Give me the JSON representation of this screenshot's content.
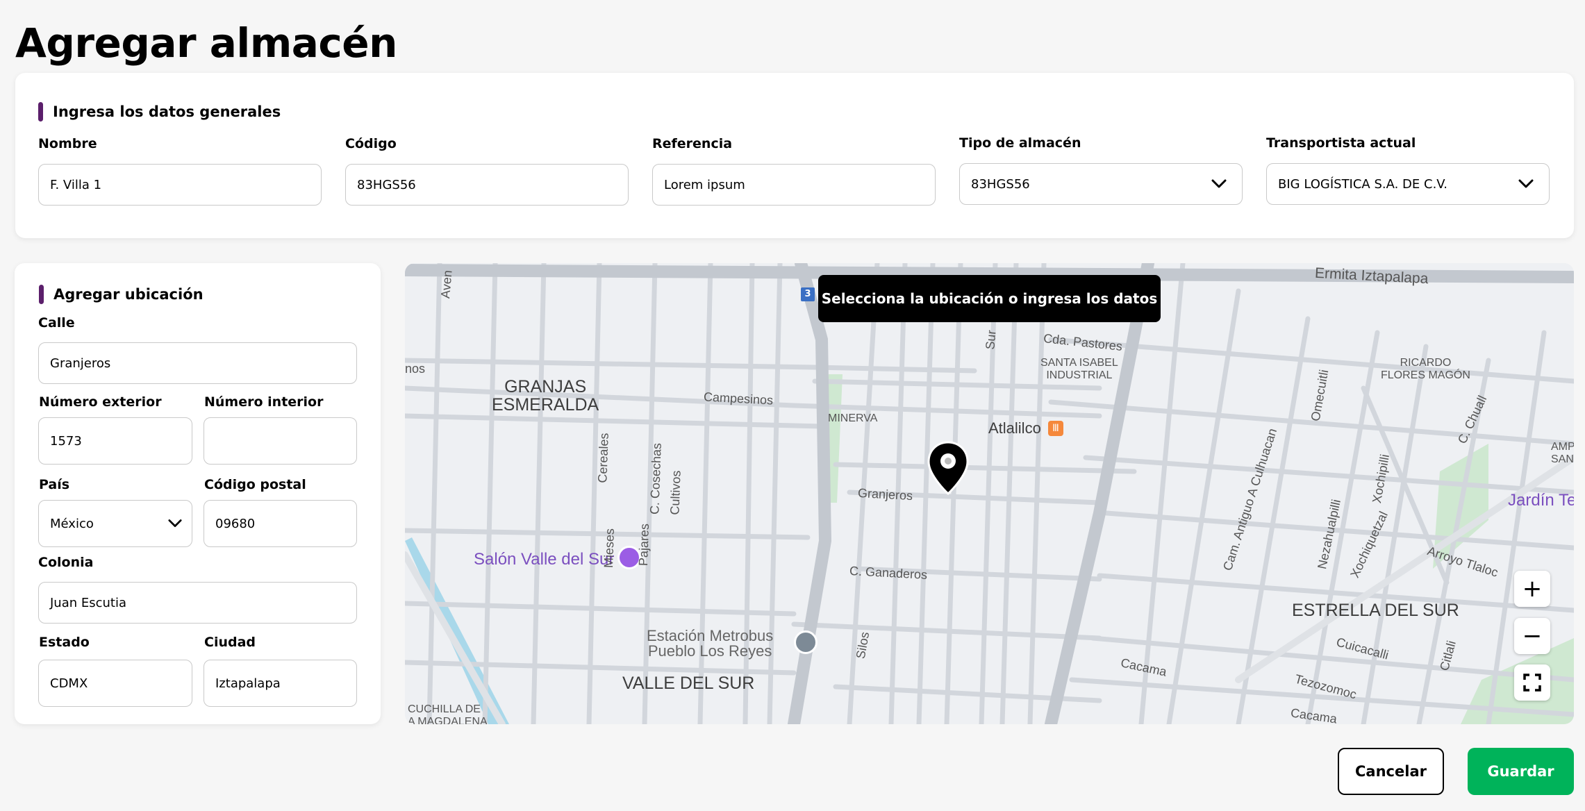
{
  "page": {
    "title": "Agregar almacén"
  },
  "general": {
    "section_title": "Ingresa los datos generales",
    "fields": {
      "nombre": {
        "label": "Nombre",
        "value": "F. Villa 1"
      },
      "codigo": {
        "label": "Código",
        "value": "83HGS56"
      },
      "referencia": {
        "label": "Referencia",
        "value": "Lorem ipsum"
      },
      "tipo": {
        "label": "Tipo de almacén",
        "value": "83HGS56"
      },
      "transportista": {
        "label": "Transportista actual",
        "value": "BIG LOGÍSTICA S.A. DE C.V."
      }
    }
  },
  "location": {
    "section_title": "Agregar ubicación",
    "fields": {
      "calle": {
        "label": "Calle",
        "value": "Granjeros"
      },
      "num_ext": {
        "label": "Número exterior",
        "value": "1573"
      },
      "num_int": {
        "label": "Número interior",
        "value": ""
      },
      "pais": {
        "label": "País",
        "value": "México"
      },
      "cp": {
        "label": "Código postal",
        "value": "09680"
      },
      "colonia": {
        "label": "Colonia",
        "value": "Juan Escutia"
      },
      "estado": {
        "label": "Estado",
        "value": "CDMX"
      },
      "ciudad": {
        "label": "Ciudad",
        "value": "Iztapalapa"
      }
    }
  },
  "map": {
    "tooltip": "Selecciona la ubicación o ingresa los datos",
    "zoom_in": "+",
    "zoom_out": "−",
    "fullscreen_icon": "fullscreen-icon",
    "marker_icon": "map-pin-icon",
    "labels": {
      "granjas": "GRANJAS\nESMERALDA",
      "valle": "VALLE DEL SUR",
      "estrella": "ESTRELLA DEL SUR",
      "santa_isabel": "SANTA ISABEL\nINDUSTRIAL",
      "ricardo": "RICARDO\nFLORES MAGÓN",
      "minerva": "MINERVA",
      "atlalilco": "Atlalilco",
      "salon": "Salón Valle del Sur",
      "estacion": "Estación Metrobus\nPueblo Los Reyes",
      "jardin": "Jardín Te",
      "ermita": "Ermita Iztapalapa",
      "pastores": "Cda. Pastores",
      "campesinos": "Campesinos",
      "granjeros": "Granjeros",
      "ganaderos": "C. Ganaderos",
      "cereales": "Cereales",
      "cosechas": "C. Cosechas",
      "cultivos": "Cultivos",
      "mieses": "Mieses",
      "pajares": "Pajares",
      "silos": "Silos",
      "cam_antiguo": "Cam. Antiguo A Culhuacan",
      "nezahualpilli": "Nezahualpilli",
      "xochiquetzal": "Xochiquetzal",
      "arroyo": "Arroyo Tlaloc",
      "cuicacalli": "Cuicacalli",
      "tezozomoc": "Tezozomoc",
      "cacama": "Cacama",
      "cacama2": "Cacama",
      "cuchilla": "CUCHILLA DE\nA MAGDALENA",
      "omecuitli": "Omecuitli",
      "xochipilli": "Xochipilli",
      "chuall": "C. Chuall",
      "citlali": "Citlali",
      "amp": "AMP\nSANTU",
      "nos": "nos",
      "aven": "Aven",
      "sur": "Sur",
      "route3": "3"
    }
  },
  "actions": {
    "cancel": "Cancelar",
    "save": "Guardar"
  },
  "colors": {
    "accent": "#5b1f6b",
    "save": "#00b35a",
    "poi": "#7b4fbf"
  }
}
